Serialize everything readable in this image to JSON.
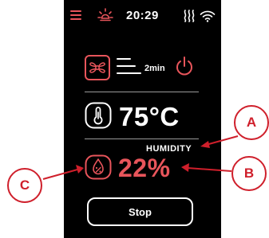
{
  "status_bar": {
    "time": "20:29",
    "icons": [
      "menu-icon",
      "light-icon",
      "heater-icon",
      "wifi-icon"
    ]
  },
  "fan": {
    "icon": "fan-icon",
    "timer": "2min",
    "power_icon": "power-icon"
  },
  "temperature": {
    "icon": "thermometer-icon",
    "value": "75°C"
  },
  "humidity": {
    "label": "HUMIDITY",
    "icon": "humidity-icon",
    "value": "22%"
  },
  "actions": {
    "stop_label": "Stop"
  },
  "callouts": {
    "a": "A",
    "b": "B",
    "c": "C"
  },
  "colors": {
    "screen_background": "#000000",
    "accent": "#e8555b",
    "text": "#ffffff",
    "callout": "#cf1f2b",
    "divider": "#9a9a9a"
  }
}
